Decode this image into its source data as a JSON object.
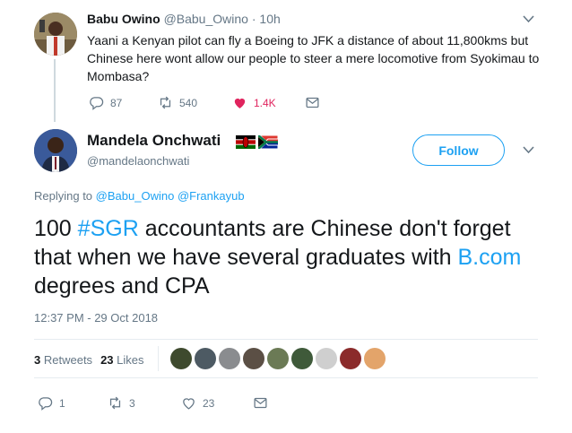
{
  "parent_tweet": {
    "display_name": "Babu Owino",
    "handle": "@Babu_Owino",
    "separator": "·",
    "time": "10h",
    "text": "Yaani a Kenyan pilot can fly a Boeing to JFK  a distance of about 11,800kms but Chinese here wont allow our people to steer a mere locomotive from Syokimau to Mombasa?",
    "replies": "87",
    "retweets": "540",
    "likes": "1.4K"
  },
  "main_tweet": {
    "display_name": "Mandela Onchwati",
    "handle": "@mandelaonchwati",
    "follow_label": "Follow",
    "replying_prefix": "Replying to",
    "replying_to": [
      "@Babu_Owino",
      "@Frankayub"
    ],
    "text_part1": "100 ",
    "hashtag": "#SGR",
    "text_part2": " accountants are Chinese don't forget that when we have several graduates with ",
    "link_text": "B.com",
    "text_part3": " degrees and CPA",
    "timestamp": "12:37 PM - 29 Oct 2018",
    "retweets_count": "3",
    "retweets_label": "Retweets",
    "likes_count": "23",
    "likes_label": "Likes",
    "replies": "1",
    "retweets": "3",
    "likes": "23"
  },
  "colors": {
    "accent": "#1da1f2",
    "like": "#e0245e",
    "muted": "#657786",
    "text": "#14171a"
  },
  "liker_avatars": [
    "#3e4a2e",
    "#4d5a63",
    "#8a8c8f",
    "#5b4f45",
    "#6b7a55",
    "#3f5a3a",
    "#cfcfcf",
    "#8b2b2b",
    "#e3a46a"
  ]
}
